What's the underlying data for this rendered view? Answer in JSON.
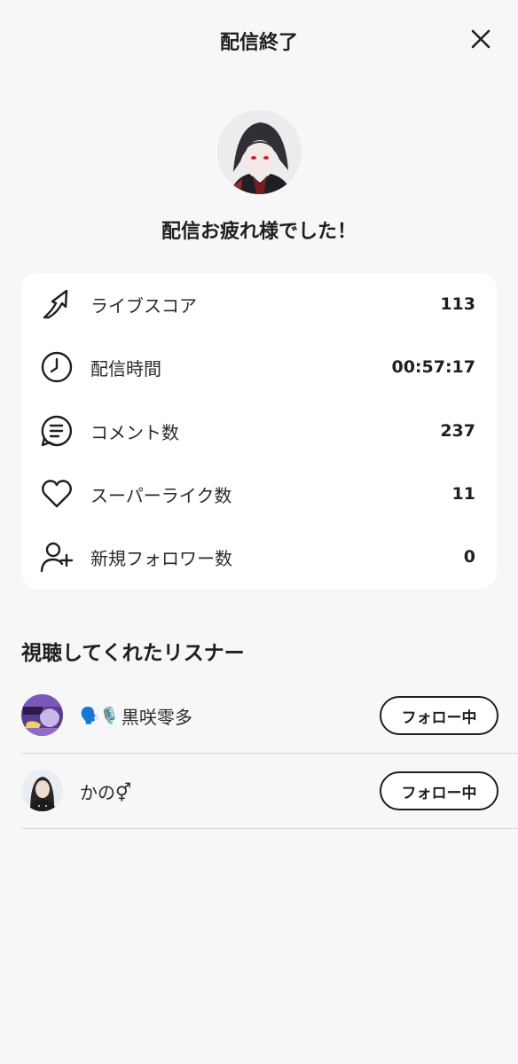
{
  "header": {
    "title": "配信終了",
    "close_icon": "close-icon"
  },
  "profile": {
    "thanks_text": "配信お疲れ様でした！"
  },
  "stats": [
    {
      "icon": "arrow-up-icon",
      "label": "ライブスコア",
      "value": "113"
    },
    {
      "icon": "clock-icon",
      "label": "配信時間",
      "value": "00:57:17"
    },
    {
      "icon": "comment-icon",
      "label": "コメント数",
      "value": "237"
    },
    {
      "icon": "heart-icon",
      "label": "スーパーライク数",
      "value": "11"
    },
    {
      "icon": "add-user-icon",
      "label": "新規フォロワー数",
      "value": "0"
    }
  ],
  "listeners_section": {
    "title": "視聴してくれたリスナー",
    "items": [
      {
        "emoji_prefix": "🗣️🎙️",
        "name": "黒咲零多",
        "button_label": "フォロー中"
      },
      {
        "emoji_prefix": "",
        "name": "かの⚥",
        "button_label": "フォロー中"
      }
    ]
  },
  "colors": {
    "background": "#f7f7f7",
    "card": "#ffffff",
    "text": "#1f1f1f",
    "divider": "#d6d6d6"
  }
}
